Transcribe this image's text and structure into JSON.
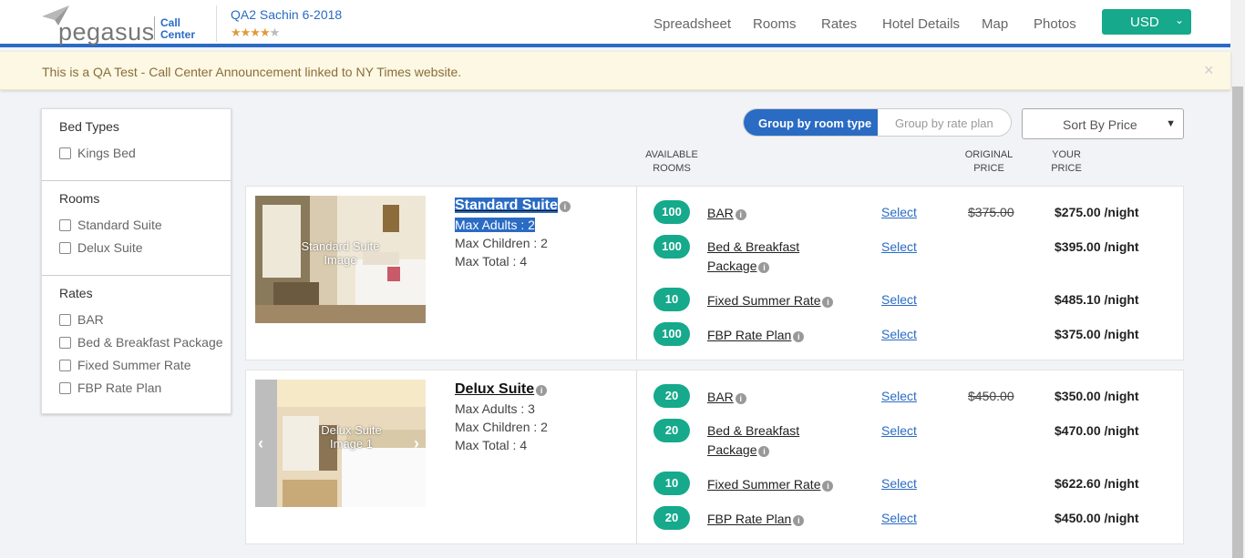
{
  "header": {
    "logo_word": "pegasus",
    "logo_sub_1": "Call",
    "logo_sub_2": "Center",
    "hotel_name": "QA2 Sachin 6-2018",
    "star_rating": 4,
    "stars_filled": "★★★★",
    "stars_empty": "★",
    "nav": [
      "Spreadsheet",
      "Rooms",
      "Rates",
      "Hotel Details",
      "Map",
      "Photos"
    ],
    "currency": "USD"
  },
  "announcement": {
    "text": "This is a QA Test - Call Center Announcement linked to NY Times website.",
    "close": "×"
  },
  "filters": {
    "bed_types": {
      "title": "Bed Types",
      "items": [
        "Kings Bed"
      ]
    },
    "rooms": {
      "title": "Rooms",
      "items": [
        "Standard Suite",
        "Delux Suite"
      ]
    },
    "rates": {
      "title": "Rates",
      "items": [
        "BAR",
        "Bed & Breakfast Package",
        "Fixed Summer Rate",
        "FBP Rate Plan"
      ]
    }
  },
  "grouping": {
    "by_room": "Group by room type",
    "by_rate": "Group by rate plan"
  },
  "sort": {
    "selected": "Sort By Price"
  },
  "columns": {
    "available_1": "AVAILABLE",
    "available_2": "ROOMS",
    "original_1": "ORIGINAL",
    "original_2": "PRICE",
    "your_1": "YOUR",
    "your_2": "PRICE"
  },
  "rooms": [
    {
      "name": "Standard Suite",
      "image_label_1": "Standard Suite",
      "image_label_2": "Image",
      "max_adults": "Max Adults : 2",
      "max_children": "Max Children : 2",
      "max_total": "Max Total : 4",
      "rates": [
        {
          "available": "100",
          "name_1": "BAR",
          "name_2": "",
          "select": "Select",
          "original": "$375.00",
          "price": "$275.00 /night"
        },
        {
          "available": "100",
          "name_1": "Bed & Breakfast",
          "name_2": "Package",
          "select": "Select",
          "original": "",
          "price": "$395.00 /night"
        },
        {
          "available": "10",
          "name_1": "Fixed Summer Rate",
          "name_2": "",
          "select": "Select",
          "original": "",
          "price": "$485.10 /night"
        },
        {
          "available": "100",
          "name_1": "FBP Rate Plan",
          "name_2": "",
          "select": "Select",
          "original": "",
          "price": "$375.00 /night"
        }
      ]
    },
    {
      "name": "Delux Suite",
      "image_label_1": "Delux Suite",
      "image_label_2": "Image 1",
      "max_adults": "Max Adults : 3",
      "max_children": "Max Children : 2",
      "max_total": "Max Total : 4",
      "rates": [
        {
          "available": "20",
          "name_1": "BAR",
          "name_2": "",
          "select": "Select",
          "original": "$450.00",
          "price": "$350.00 /night"
        },
        {
          "available": "20",
          "name_1": "Bed & Breakfast",
          "name_2": "Package",
          "select": "Select",
          "original": "",
          "price": "$470.00 /night"
        },
        {
          "available": "10",
          "name_1": "Fixed Summer Rate",
          "name_2": "",
          "select": "Select",
          "original": "",
          "price": "$622.60 /night"
        },
        {
          "available": "20",
          "name_1": "FBP Rate Plan",
          "name_2": "",
          "select": "Select",
          "original": "",
          "price": "$450.00 /night"
        }
      ]
    }
  ],
  "colors": {
    "brand_blue": "#2a6bc4",
    "teal": "#16a98b",
    "announce_bg": "#fcf8e3",
    "announce_text": "#8a6d3b"
  }
}
